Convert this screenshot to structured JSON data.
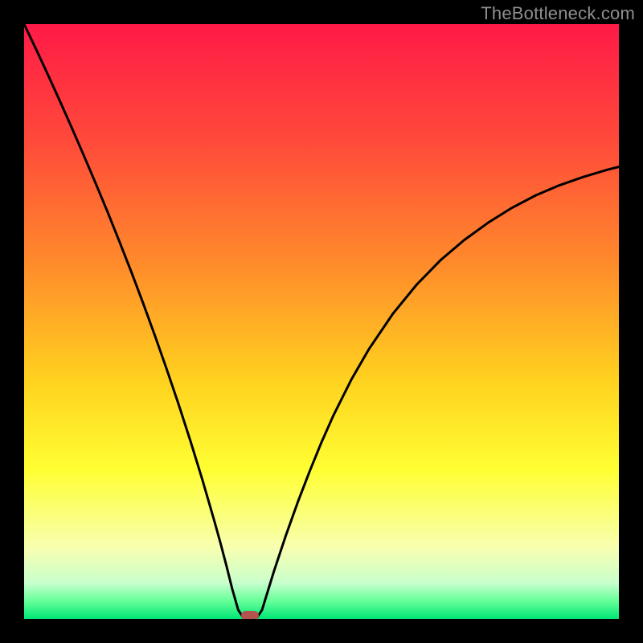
{
  "watermark": "TheBottleneck.com",
  "colors": {
    "frame": "#000000",
    "curve": "#000000",
    "marker": "#b3534f",
    "gradient_stops": [
      {
        "offset": 0.0,
        "color": "#ff1a47"
      },
      {
        "offset": 0.2,
        "color": "#ff4b3a"
      },
      {
        "offset": 0.4,
        "color": "#ff8a2b"
      },
      {
        "offset": 0.6,
        "color": "#ffd21f"
      },
      {
        "offset": 0.75,
        "color": "#ffff33"
      },
      {
        "offset": 0.88,
        "color": "#f8ffb0"
      },
      {
        "offset": 0.94,
        "color": "#c8ffcc"
      },
      {
        "offset": 0.97,
        "color": "#66ff99"
      },
      {
        "offset": 1.0,
        "color": "#00e676"
      }
    ]
  },
  "chart_data": {
    "type": "line",
    "title": "",
    "xlabel": "",
    "ylabel": "",
    "xlim": [
      0,
      100
    ],
    "ylim": [
      0,
      100
    ],
    "grid": false,
    "legend": false,
    "x": [
      0,
      2,
      4,
      6,
      8,
      10,
      12,
      14,
      16,
      18,
      20,
      22,
      24,
      26,
      28,
      30,
      32,
      33,
      34,
      35,
      36,
      37,
      38,
      39,
      40,
      42,
      44,
      46,
      48,
      50,
      52,
      55,
      58,
      62,
      66,
      70,
      74,
      78,
      82,
      86,
      90,
      94,
      98,
      100
    ],
    "values": [
      100,
      95.8,
      91.5,
      87.1,
      82.6,
      78.0,
      73.3,
      68.5,
      63.5,
      58.4,
      53.1,
      47.6,
      41.9,
      36.0,
      29.8,
      23.3,
      16.4,
      12.8,
      9.0,
      5.0,
      1.5,
      0.0,
      0.0,
      0.0,
      1.5,
      8.0,
      14.0,
      19.6,
      24.8,
      29.7,
      34.2,
      40.2,
      45.4,
      51.3,
      56.2,
      60.3,
      63.7,
      66.6,
      69.1,
      71.2,
      72.9,
      74.3,
      75.5,
      76.0
    ],
    "minimum_marker": {
      "x": 38,
      "y": 0
    }
  }
}
